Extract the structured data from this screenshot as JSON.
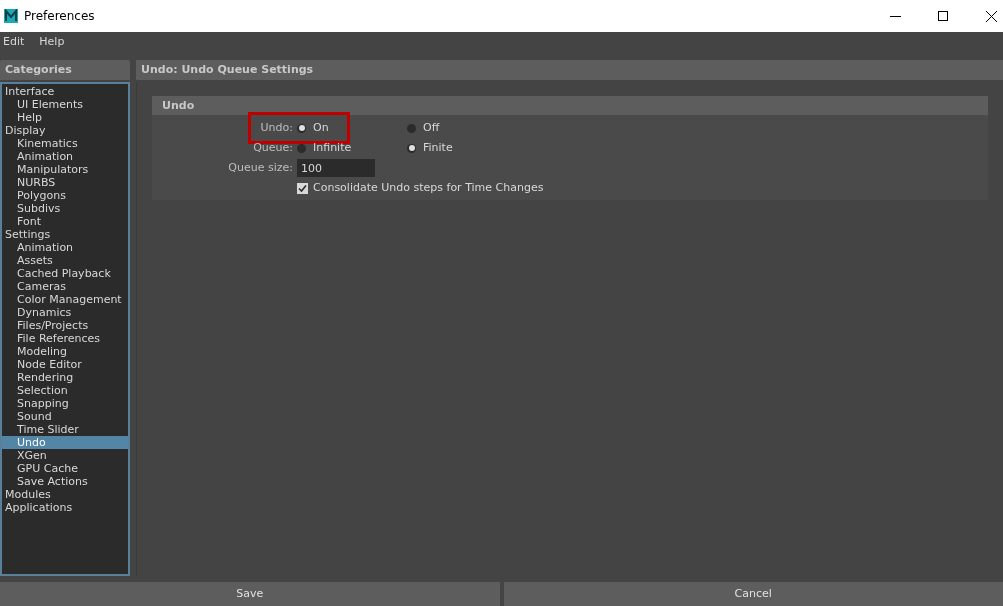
{
  "window": {
    "title": "Preferences"
  },
  "menu": [
    "Edit",
    "Help"
  ],
  "sidebar": {
    "title": "Categories",
    "items": [
      {
        "label": "Interface",
        "selected": false,
        "children": [
          {
            "label": "UI Elements",
            "selected": false
          },
          {
            "label": "Help",
            "selected": false
          }
        ]
      },
      {
        "label": "Display",
        "selected": false,
        "children": [
          {
            "label": "Kinematics",
            "selected": false
          },
          {
            "label": "Animation",
            "selected": false
          },
          {
            "label": "Manipulators",
            "selected": false
          },
          {
            "label": "NURBS",
            "selected": false
          },
          {
            "label": "Polygons",
            "selected": false
          },
          {
            "label": "Subdivs",
            "selected": false
          },
          {
            "label": "Font",
            "selected": false
          }
        ]
      },
      {
        "label": "Settings",
        "selected": false,
        "children": [
          {
            "label": "Animation",
            "selected": false
          },
          {
            "label": "Assets",
            "selected": false
          },
          {
            "label": "Cached Playback",
            "selected": false
          },
          {
            "label": "Cameras",
            "selected": false
          },
          {
            "label": "Color Management",
            "selected": false
          },
          {
            "label": "Dynamics",
            "selected": false
          },
          {
            "label": "Files/Projects",
            "selected": false
          },
          {
            "label": "File References",
            "selected": false
          },
          {
            "label": "Modeling",
            "selected": false
          },
          {
            "label": "Node Editor",
            "selected": false
          },
          {
            "label": "Rendering",
            "selected": false
          },
          {
            "label": "Selection",
            "selected": false
          },
          {
            "label": "Snapping",
            "selected": false
          },
          {
            "label": "Sound",
            "selected": false
          },
          {
            "label": "Time Slider",
            "selected": false
          },
          {
            "label": "Undo",
            "selected": true
          },
          {
            "label": "XGen",
            "selected": false
          },
          {
            "label": "GPU Cache",
            "selected": false
          },
          {
            "label": "Save Actions",
            "selected": false
          }
        ]
      },
      {
        "label": "Modules",
        "selected": false
      },
      {
        "label": "Applications",
        "selected": false
      }
    ]
  },
  "panel": {
    "title": "Undo: Undo Queue Settings",
    "section": "Undo",
    "rows": [
      {
        "kind": "radio",
        "label": "Undo:",
        "highlighted": true,
        "options": [
          {
            "label": "On",
            "selected": true
          },
          {
            "label": "Off",
            "selected": false
          }
        ]
      },
      {
        "kind": "radio",
        "label": "Queue:",
        "highlighted": false,
        "options": [
          {
            "label": "Infinite",
            "selected": false
          },
          {
            "label": "Finite",
            "selected": true
          }
        ]
      },
      {
        "kind": "field",
        "label": "Queue size:",
        "value": "100"
      },
      {
        "kind": "checkbox",
        "label": "Consolidate Undo steps for Time Changes",
        "checked": true
      }
    ]
  },
  "buttons": [
    "Save",
    "Cancel"
  ]
}
